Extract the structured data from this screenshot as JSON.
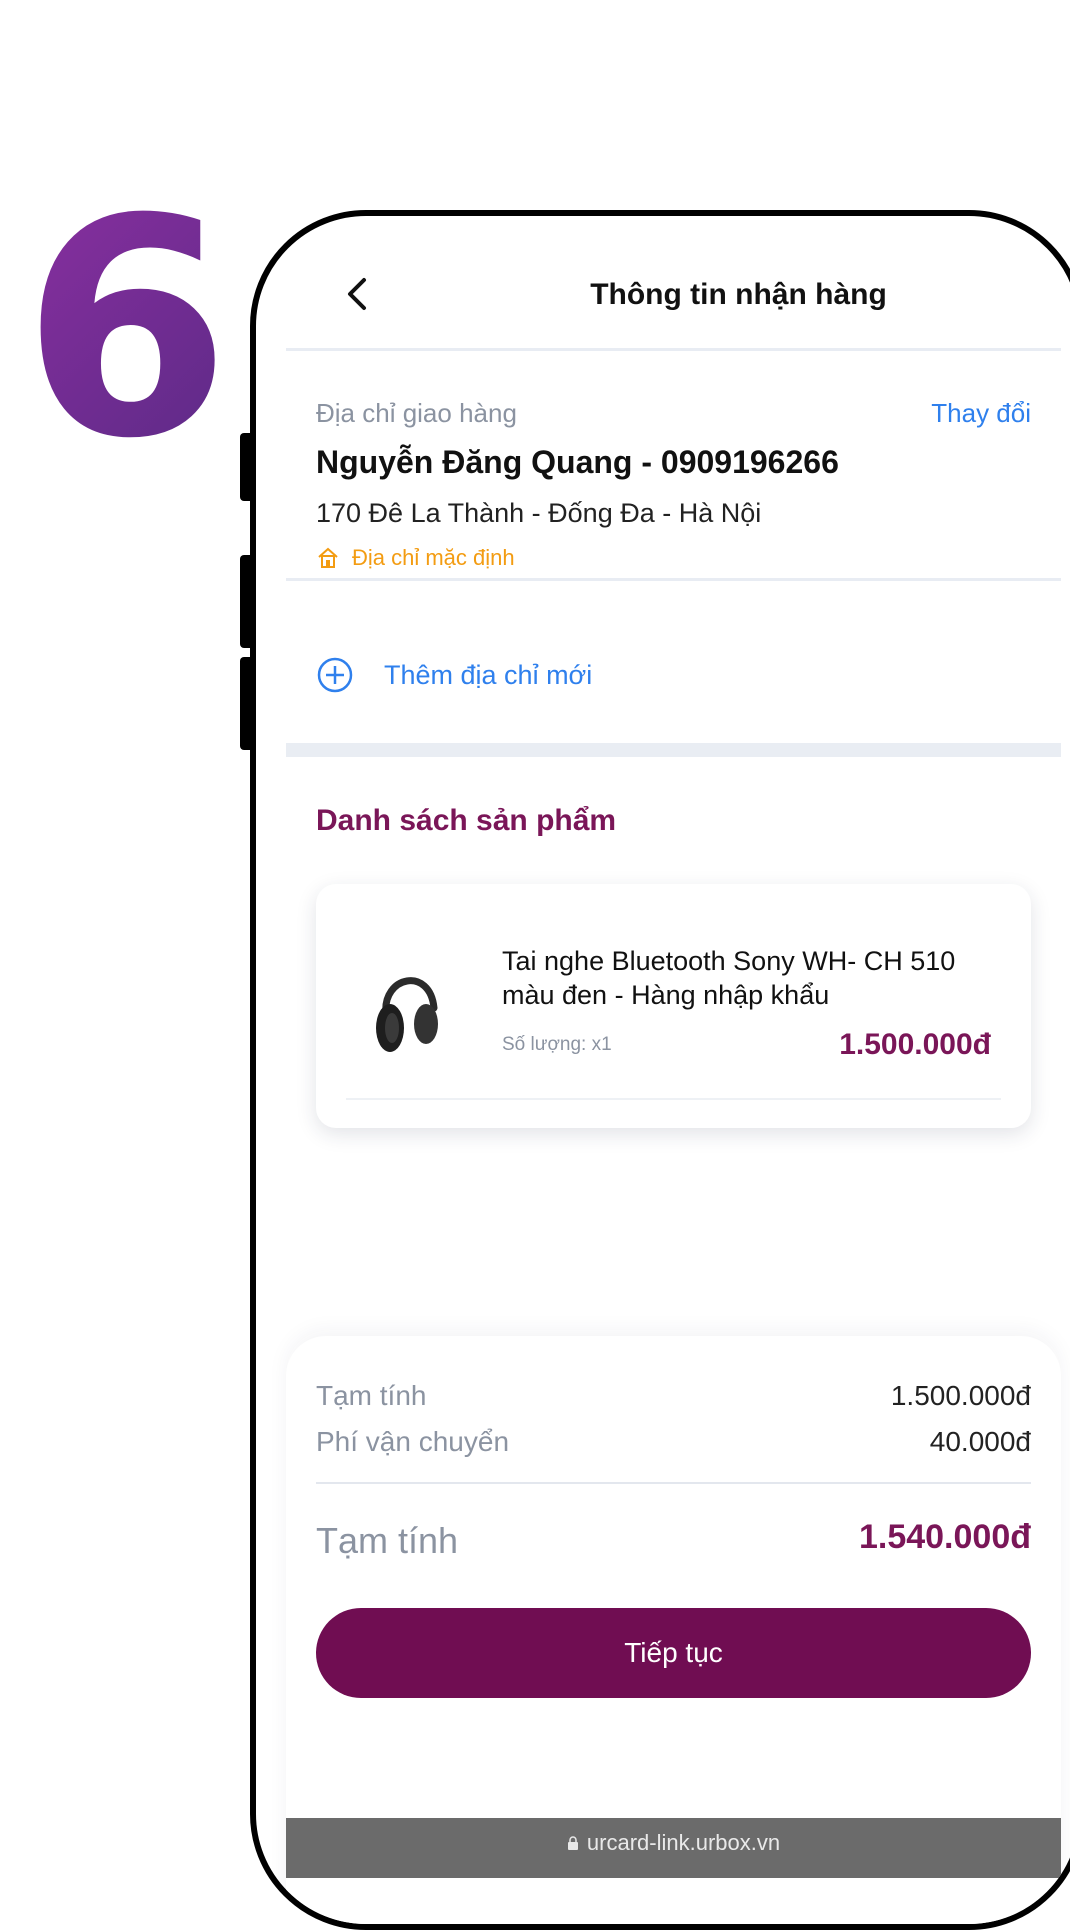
{
  "step_number": "6",
  "header": {
    "title": "Thông tin nhận hàng"
  },
  "address": {
    "label": "Địa chỉ giao hàng",
    "change": "Thay đổi",
    "name_phone": "Nguyễn Đăng Quang - 0909196266",
    "street": "170 Đê La Thành - Đống Đa - Hà Nội",
    "default_label": "Địa chỉ mặc định"
  },
  "add_address": {
    "label": "Thêm địa chỉ mới"
  },
  "products": {
    "title": "Danh sách sản phẩm",
    "items": [
      {
        "name": "Tai nghe Bluetooth Sony WH- CH 510 màu đen - Hàng nhập khẩu",
        "quantity": "Số lượng: x1",
        "price": "1.500.000đ"
      }
    ]
  },
  "summary": {
    "subtotal_label": "Tạm tính",
    "subtotal_value": "1.500.000đ",
    "shipping_label": "Phí vận chuyển",
    "shipping_value": "40.000đ",
    "total_label": "Tạm tính",
    "total_value": "1.540.000đ"
  },
  "continue_button": "Tiếp tục",
  "url": "urcard-link.urbox.vn",
  "colors": {
    "brand": "#700d52",
    "link": "#2f80ed",
    "default_tag": "#f39c12"
  }
}
